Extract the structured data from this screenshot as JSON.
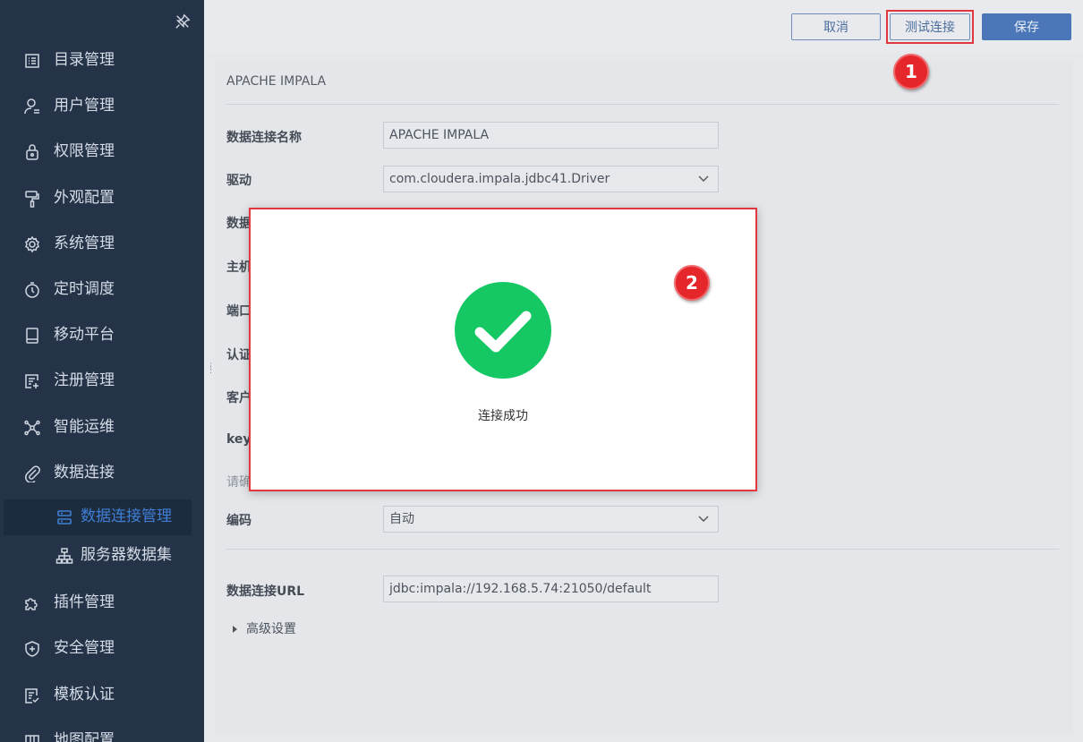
{
  "sidebar": {
    "items": [
      {
        "label": "目录管理",
        "icon": "list-icon"
      },
      {
        "label": "用户管理",
        "icon": "user-icon"
      },
      {
        "label": "权限管理",
        "icon": "lock-icon"
      },
      {
        "label": "外观配置",
        "icon": "paint-roller-icon"
      },
      {
        "label": "系统管理",
        "icon": "gear-icon"
      },
      {
        "label": "定时调度",
        "icon": "timer-icon"
      },
      {
        "label": "移动平台",
        "icon": "tablet-icon"
      },
      {
        "label": "注册管理",
        "icon": "register-icon"
      },
      {
        "label": "智能运维",
        "icon": "network-icon"
      },
      {
        "label": "数据连接",
        "icon": "paperclip-icon"
      },
      {
        "label": "数据连接管理",
        "icon": "database-icon"
      },
      {
        "label": "服务器数据集",
        "icon": "hierarchy-icon"
      },
      {
        "label": "插件管理",
        "icon": "puzzle-icon"
      },
      {
        "label": "安全管理",
        "icon": "shield-icon"
      },
      {
        "label": "模板认证",
        "icon": "document-check-icon"
      },
      {
        "label": "地图配置",
        "icon": "map-icon"
      }
    ],
    "active_color": "#3f7fd4"
  },
  "toolbar": {
    "cancel_label": "取消",
    "test_label": "测试连接",
    "save_label": "保存"
  },
  "annotations": {
    "badge1": "1",
    "badge2": "2"
  },
  "form": {
    "title": "APACHE IMPALA",
    "labels": {
      "name": "数据连接名称",
      "driver": "驱动",
      "database": "数据",
      "host": "主机",
      "port": "端口",
      "auth": "认证",
      "client": "客户",
      "key": "key",
      "hint": "请确",
      "encoding": "编码",
      "url": "数据连接URL"
    },
    "values": {
      "name": "APACHE IMPALA",
      "driver": "com.cloudera.impala.jdbc41.Driver",
      "encoding": "自动",
      "url": "jdbc:impala://192.168.5.74:21050/default"
    },
    "advanced_label": "高级设置"
  },
  "dialog": {
    "message": "连接成功",
    "icon": "check-circle-icon",
    "success_color": "#16c864"
  }
}
